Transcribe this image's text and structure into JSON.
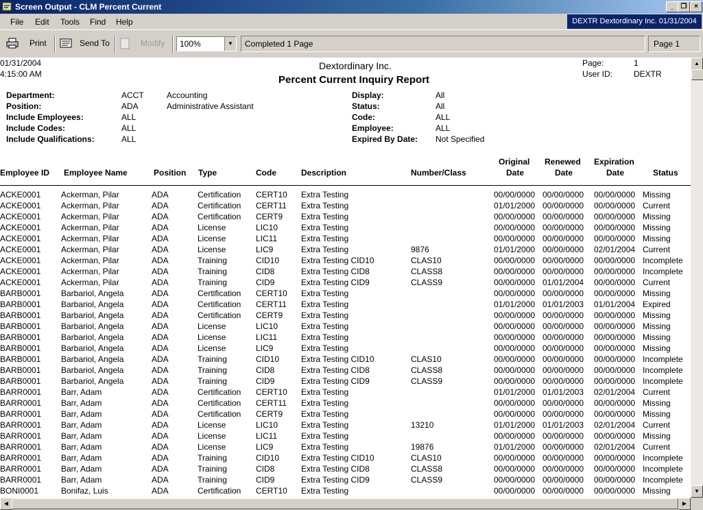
{
  "window": {
    "title": "Screen Output - CLM Percent Current"
  },
  "menu": {
    "file": "File",
    "edit": "Edit",
    "tools": "Tools",
    "find": "Find",
    "help": "Help"
  },
  "userinfo": "DEXTR  Dextordinary Inc.  01/31/2004",
  "toolbar": {
    "print": "Print",
    "send_to": "Send To",
    "modify": "Modify",
    "zoom": "100%",
    "status": "Completed 1 Page",
    "page": "Page 1"
  },
  "report": {
    "date": "01/31/2004",
    "time": "4:15:00  AM",
    "company": "Dextordinary Inc.",
    "title": "Percent Current Inquiry Report",
    "page_label": "Page:",
    "page_value": "1",
    "user_label": "User ID:",
    "user_value": "DEXTR",
    "filters_left": [
      {
        "label": "Department:",
        "code": "ACCT",
        "desc": "Accounting"
      },
      {
        "label": "Position:",
        "code": "ADA",
        "desc": "Administrative Assistant"
      },
      {
        "label": "Include Employees:",
        "code": "ALL",
        "desc": ""
      },
      {
        "label": "Include Codes:",
        "code": "ALL",
        "desc": ""
      },
      {
        "label": "Include Qualifications:",
        "code": "ALL",
        "desc": ""
      }
    ],
    "filters_right": [
      {
        "label": "Display:",
        "value": "All"
      },
      {
        "label": "Status:",
        "value": "All"
      },
      {
        "label": "Code:",
        "value": "ALL"
      },
      {
        "label": "Employee:",
        "value": "ALL"
      },
      {
        "label": "Expired By Date:",
        "value": "Not Specified"
      }
    ],
    "headers": {
      "emp_id": "Employee ID",
      "name": "Employee Name",
      "position": "Position",
      "type": "Type",
      "code": "Code",
      "description": "Description",
      "number": "Number/Class",
      "orig1": "Original",
      "orig2": "Date",
      "ren1": "Renewed",
      "ren2": "Date",
      "exp1": "Expiration",
      "exp2": "Date",
      "status": "Status"
    },
    "rows": [
      [
        "ACKE0001",
        "Ackerman, Pilar",
        "ADA",
        "Certification",
        "CERT10",
        "Extra Testing",
        "",
        "00/00/0000",
        "00/00/0000",
        "00/00/0000",
        "Missing"
      ],
      [
        "ACKE0001",
        "Ackerman, Pilar",
        "ADA",
        "Certification",
        "CERT11",
        "Extra Testing",
        "",
        "01/01/2000",
        "00/00/0000",
        "00/00/0000",
        "Current"
      ],
      [
        "ACKE0001",
        "Ackerman, Pilar",
        "ADA",
        "Certification",
        "CERT9",
        "Extra Testing",
        "",
        "00/00/0000",
        "00/00/0000",
        "00/00/0000",
        "Missing"
      ],
      [
        "ACKE0001",
        "Ackerman, Pilar",
        "ADA",
        "License",
        "LIC10",
        "Extra Testing",
        "",
        "00/00/0000",
        "00/00/0000",
        "00/00/0000",
        "Missing"
      ],
      [
        "ACKE0001",
        "Ackerman, Pilar",
        "ADA",
        "License",
        "LIC11",
        "Extra Testing",
        "",
        "00/00/0000",
        "00/00/0000",
        "00/00/0000",
        "Missing"
      ],
      [
        "ACKE0001",
        "Ackerman, Pilar",
        "ADA",
        "License",
        "LIC9",
        "Extra Testing",
        "9876",
        "01/01/2000",
        "00/00/0000",
        "02/01/2004",
        "Current"
      ],
      [
        "ACKE0001",
        "Ackerman, Pilar",
        "ADA",
        "Training",
        "CID10",
        "Extra Testing CID10",
        "CLAS10",
        "00/00/0000",
        "00/00/0000",
        "00/00/0000",
        "Incomplete"
      ],
      [
        "ACKE0001",
        "Ackerman, Pilar",
        "ADA",
        "Training",
        "CID8",
        "Extra Testing CID8",
        "CLASS8",
        "00/00/0000",
        "00/00/0000",
        "00/00/0000",
        "Incomplete"
      ],
      [
        "ACKE0001",
        "Ackerman, Pilar",
        "ADA",
        "Training",
        "CID9",
        "Extra Testing CID9",
        "CLASS9",
        "00/00/0000",
        "01/01/2004",
        "00/00/0000",
        "Current"
      ],
      [
        "BARB0001",
        "Barbariol, Angela",
        "ADA",
        "Certification",
        "CERT10",
        "Extra Testing",
        "",
        "00/00/0000",
        "00/00/0000",
        "00/00/0000",
        "Missing"
      ],
      [
        "BARB0001",
        "Barbariol, Angela",
        "ADA",
        "Certification",
        "CERT11",
        "Extra Testing",
        "",
        "01/01/2000",
        "01/01/2003",
        "01/01/2004",
        "Expired"
      ],
      [
        "BARB0001",
        "Barbariol, Angela",
        "ADA",
        "Certification",
        "CERT9",
        "Extra Testing",
        "",
        "00/00/0000",
        "00/00/0000",
        "00/00/0000",
        "Missing"
      ],
      [
        "BARB0001",
        "Barbariol, Angela",
        "ADA",
        "License",
        "LIC10",
        "Extra Testing",
        "",
        "00/00/0000",
        "00/00/0000",
        "00/00/0000",
        "Missing"
      ],
      [
        "BARB0001",
        "Barbariol, Angela",
        "ADA",
        "License",
        "LIC11",
        "Extra Testing",
        "",
        "00/00/0000",
        "00/00/0000",
        "00/00/0000",
        "Missing"
      ],
      [
        "BARB0001",
        "Barbariol, Angela",
        "ADA",
        "License",
        "LIC9",
        "Extra Testing",
        "",
        "00/00/0000",
        "00/00/0000",
        "00/00/0000",
        "Missing"
      ],
      [
        "BARB0001",
        "Barbariol, Angela",
        "ADA",
        "Training",
        "CID10",
        "Extra Testing CID10",
        "CLAS10",
        "00/00/0000",
        "00/00/0000",
        "00/00/0000",
        "Incomplete"
      ],
      [
        "BARB0001",
        "Barbariol, Angela",
        "ADA",
        "Training",
        "CID8",
        "Extra Testing CID8",
        "CLASS8",
        "00/00/0000",
        "00/00/0000",
        "00/00/0000",
        "Incomplete"
      ],
      [
        "BARB0001",
        "Barbariol, Angela",
        "ADA",
        "Training",
        "CID9",
        "Extra Testing CID9",
        "CLASS9",
        "00/00/0000",
        "00/00/0000",
        "00/00/0000",
        "Incomplete"
      ],
      [
        "BARR0001",
        "Barr, Adam",
        "ADA",
        "Certification",
        "CERT10",
        "Extra Testing",
        "",
        "01/01/2000",
        "01/01/2003",
        "02/01/2004",
        "Current"
      ],
      [
        "BARR0001",
        "Barr, Adam",
        "ADA",
        "Certification",
        "CERT11",
        "Extra Testing",
        "",
        "00/00/0000",
        "00/00/0000",
        "00/00/0000",
        "Missing"
      ],
      [
        "BARR0001",
        "Barr, Adam",
        "ADA",
        "Certification",
        "CERT9",
        "Extra Testing",
        "",
        "00/00/0000",
        "00/00/0000",
        "00/00/0000",
        "Missing"
      ],
      [
        "BARR0001",
        "Barr, Adam",
        "ADA",
        "License",
        "LIC10",
        "Extra Testing",
        "13210",
        "01/01/2000",
        "01/01/2003",
        "02/01/2004",
        "Current"
      ],
      [
        "BARR0001",
        "Barr, Adam",
        "ADA",
        "License",
        "LIC11",
        "Extra Testing",
        "",
        "00/00/0000",
        "00/00/0000",
        "00/00/0000",
        "Missing"
      ],
      [
        "BARR0001",
        "Barr, Adam",
        "ADA",
        "License",
        "LIC9",
        "Extra Testing",
        "19876",
        "01/01/2000",
        "00/00/0000",
        "02/01/2004",
        "Current"
      ],
      [
        "BARR0001",
        "Barr, Adam",
        "ADA",
        "Training",
        "CID10",
        "Extra Testing CID10",
        "CLAS10",
        "00/00/0000",
        "00/00/0000",
        "00/00/0000",
        "Incomplete"
      ],
      [
        "BARR0001",
        "Barr, Adam",
        "ADA",
        "Training",
        "CID8",
        "Extra Testing CID8",
        "CLASS8",
        "00/00/0000",
        "00/00/0000",
        "00/00/0000",
        "Incomplete"
      ],
      [
        "BARR0001",
        "Barr, Adam",
        "ADA",
        "Training",
        "CID9",
        "Extra Testing CID9",
        "CLASS9",
        "00/00/0000",
        "00/00/0000",
        "00/00/0000",
        "Incomplete"
      ],
      [
        "BONI0001",
        "Bonifaz, Luis",
        "ADA",
        "Certification",
        "CERT10",
        "Extra Testing",
        "",
        "00/00/0000",
        "00/00/0000",
        "00/00/0000",
        "Missing"
      ]
    ]
  }
}
